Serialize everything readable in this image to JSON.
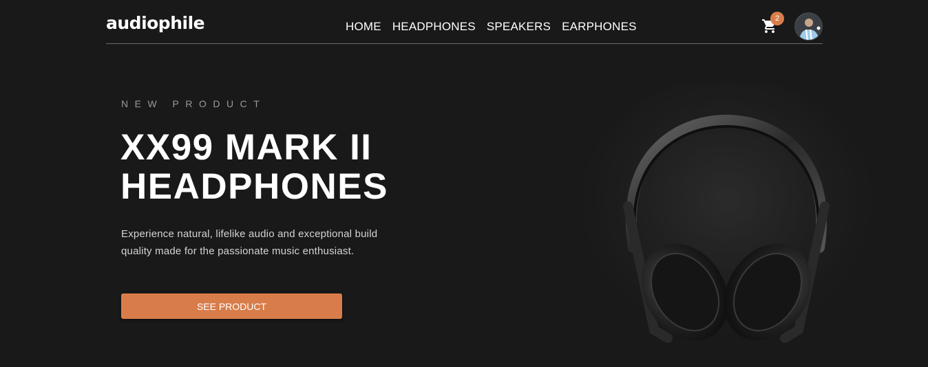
{
  "header": {
    "logo": "audiophile",
    "nav": [
      "HOME",
      "HEADPHONES",
      "SPEAKERS",
      "EARPHONES"
    ],
    "cart_count": "2",
    "icons": {
      "cart": "cart-icon",
      "avatar": "user-avatar"
    }
  },
  "hero": {
    "overline": "NEW PRODUCT",
    "title_line1": "XX99 MARK II",
    "title_line2": "HEADPHONES",
    "description": "Experience natural, lifelike audio and exceptional build quality made for the passionate music enthusiast.",
    "cta_label": "SEE PRODUCT"
  },
  "colors": {
    "background": "#191919",
    "accent": "#d87d4a",
    "text": "#ffffff",
    "muted": "#9a9a9a"
  }
}
